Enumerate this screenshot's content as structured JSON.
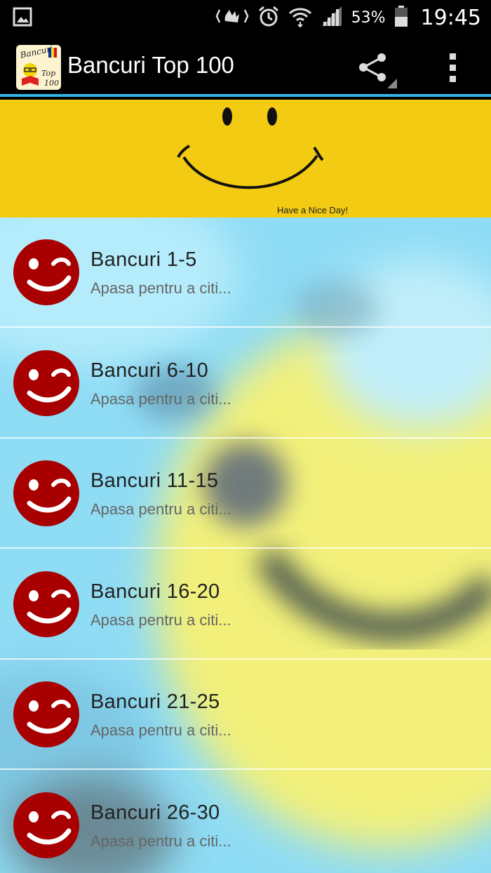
{
  "status_bar": {
    "battery_percent": "53%",
    "time": "19:45",
    "icons": [
      "gallery-notification-icon",
      "nfc-icon",
      "alarm-icon",
      "wifi-icon",
      "signal-icon",
      "battery-icon"
    ]
  },
  "app_bar": {
    "title": "Bancuri Top 100",
    "app_icon": "bancuri-top-100-logo",
    "actions": [
      "share-icon",
      "overflow-menu-icon"
    ]
  },
  "banner": {
    "caption": "Have a Nice Day!",
    "image": "smiley-face"
  },
  "list": {
    "items": [
      {
        "title": "Bancuri 1-5",
        "subtitle": "Apasa pentru a citi..."
      },
      {
        "title": "Bancuri 6-10",
        "subtitle": "Apasa pentru a citi..."
      },
      {
        "title": "Bancuri 11-15",
        "subtitle": "Apasa pentru a citi..."
      },
      {
        "title": "Bancuri 16-20",
        "subtitle": "Apasa pentru a citi..."
      },
      {
        "title": "Bancuri 21-25",
        "subtitle": "Apasa pentru a citi..."
      },
      {
        "title": "Bancuri 26-30",
        "subtitle": "Apasa pentru a citi..."
      }
    ]
  },
  "colors": {
    "accent": "#33b5e5",
    "banner": "#f3cb12",
    "row_icon": "#a80000",
    "list_bg": "#8fdcf5"
  }
}
